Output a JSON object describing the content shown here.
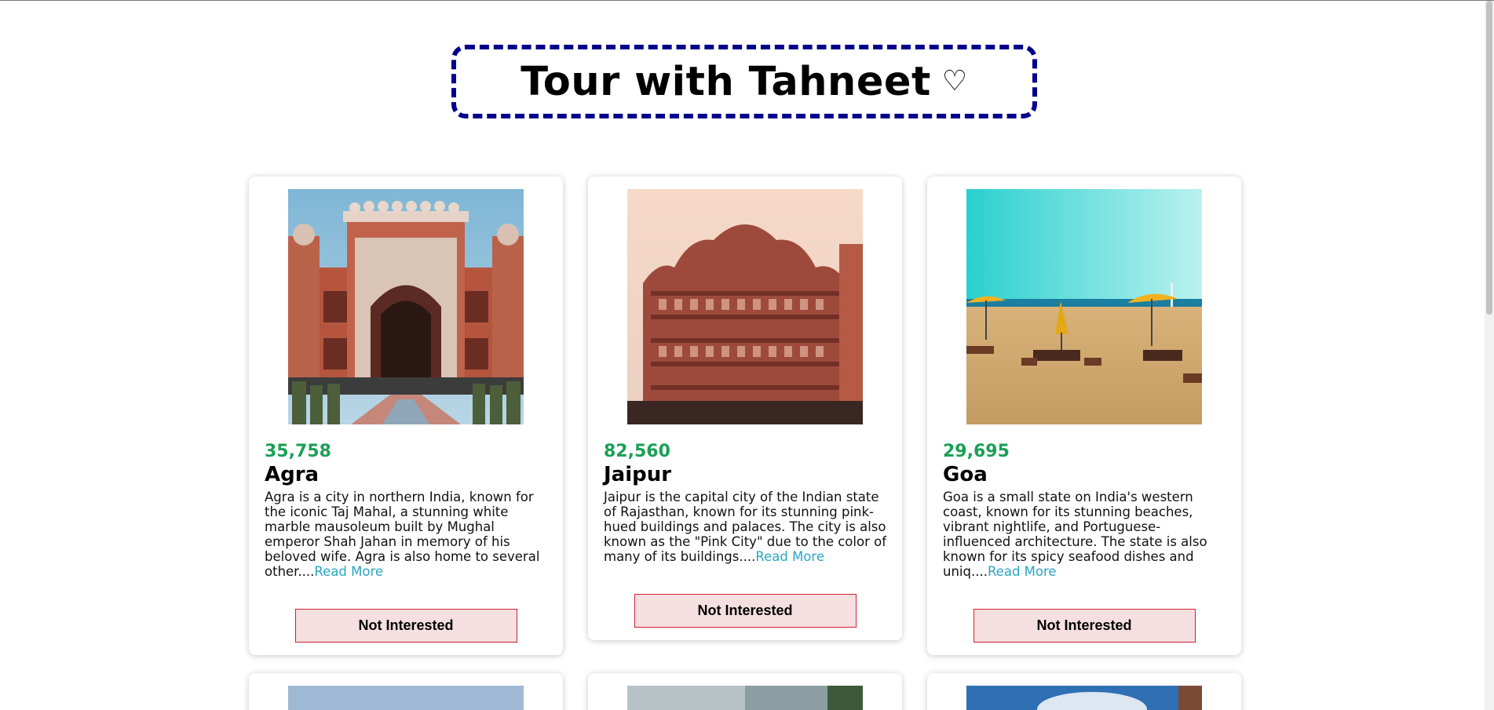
{
  "header": {
    "title": "Tour with Tahneet",
    "heart": "♡"
  },
  "tours": [
    {
      "price": "35,758",
      "name": "Agra",
      "description": "Agra is a city in northern India, known for the iconic Taj Mahal, a stunning white marble mausoleum built by Mughal emperor Shah Jahan in memory of his beloved wife. Agra is also home to several other....",
      "read_more": "Read More",
      "button": "Not Interested",
      "image_subject": "agra-gate"
    },
    {
      "price": "82,560",
      "name": "Jaipur",
      "description": "Jaipur is the capital city of the Indian state of Rajasthan, known for its stunning pink-hued buildings and palaces. The city is also known as the \"Pink City\" due to the color of many of its buildings....",
      "read_more": "Read More",
      "button": "Not Interested",
      "image_subject": "hawa-mahal"
    },
    {
      "price": "29,695",
      "name": "Goa",
      "description": "Goa is a small state on India's western coast, known for its stunning beaches, vibrant nightlife, and Portuguese-influenced architecture. The state is also known for its spicy seafood dishes and uniq....",
      "read_more": "Read More",
      "button": "Not Interested",
      "image_subject": "goa-beach"
    }
  ],
  "colors": {
    "price": "#1aa055",
    "link": "#2aa5c2",
    "title_border": "#00008b",
    "button_bg": "#f5dfe0",
    "button_border": "#d0212f"
  }
}
